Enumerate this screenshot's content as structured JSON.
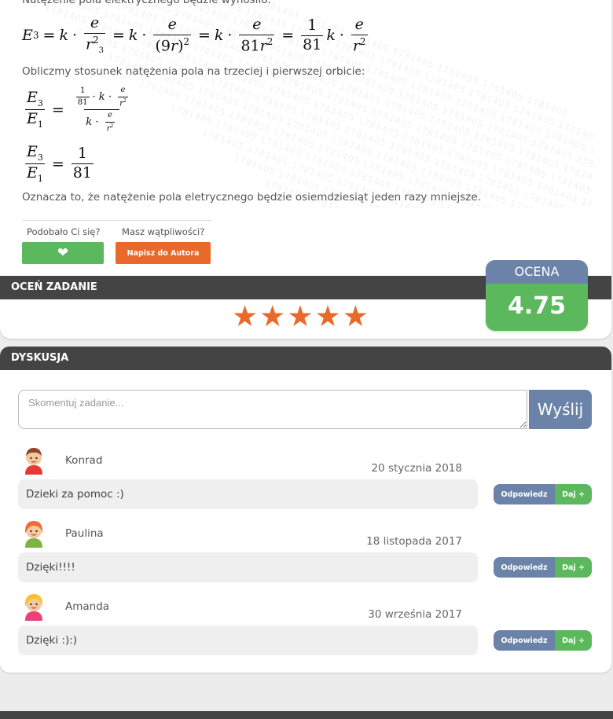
{
  "solution": {
    "intro_text": "Natężenie pola elektrycznego będzie wynosiło:",
    "ratio_text": "Obliczmy stosunek natężenia pola na trzeciej i pierwszej orbicie:",
    "conclusion_text": "Oznacza to, że natężenie pola eletrycznego będzie osiemdziesiąt jeden razy mniejsze.",
    "watermark": "1781405 1781405 1781405 1781405 1781405 1781405 1781405 1781405"
  },
  "feedback": {
    "liked_label": "Podobało Ci się?",
    "doubt_label": "Masz wątpliwości?",
    "author_button": "Napisz do Autora"
  },
  "rating": {
    "header": "OCEŃ ZADANIE",
    "stars": [
      "★",
      "★",
      "★",
      "★",
      "★"
    ],
    "score_label": "OCENA",
    "score_value": "4.75"
  },
  "discussion": {
    "header": "DYSKUSJA",
    "input_placeholder": "Skomentuj zadanie...",
    "send_label": "Wyślij",
    "comments": [
      {
        "author": "Konrad",
        "date": "20 stycznia 2018",
        "text": "Dzieki za pomoc :)",
        "reply": "Odpowiedz",
        "give": "Daj +"
      },
      {
        "author": "Paulina",
        "date": "18 listopada 2017",
        "text": "Dzięki!!!!",
        "reply": "Odpowiedz",
        "give": "Daj +"
      },
      {
        "author": "Amanda",
        "date": "30 września 2017",
        "text": "Dzięki :):)",
        "reply": "Odpowiedz",
        "give": "Daj +"
      }
    ]
  },
  "colors": {
    "accent_blue": "#6b83a8",
    "green": "#5cb85c",
    "orange": "#e8692b",
    "dark_bar": "#444444"
  }
}
